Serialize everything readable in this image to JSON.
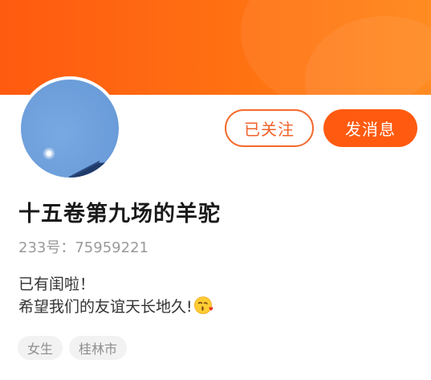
{
  "colors": {
    "accent": "#ff5a10",
    "banner_left": "#ff5a10",
    "banner_right": "#ff8415",
    "text_primary": "#1a1a1a",
    "text_secondary": "#9a9a9a",
    "tag_bg": "#f2f2f2"
  },
  "profile": {
    "name": "十五卷第九场的羊驼",
    "uid": "233号：75959221",
    "bio_lines": [
      "已有闺啦！",
      "希望我们的友谊天长地久!"
    ],
    "bio_emoji": "kissing-heart-emoji",
    "tags": [
      "女生",
      "桂林市"
    ]
  },
  "actions": {
    "follow_label": "已关注",
    "message_label": "发消息"
  }
}
